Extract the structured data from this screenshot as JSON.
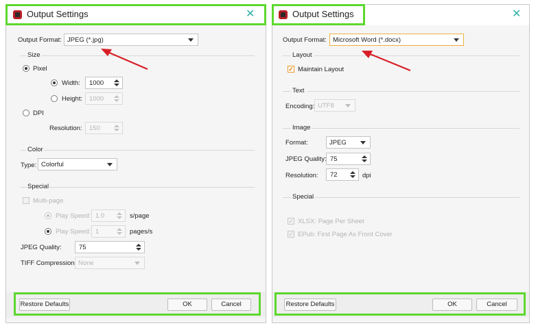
{
  "left": {
    "title": "Output Settings",
    "output_format_label": "Output Format:",
    "output_format_value": "JPEG (*.jpg)",
    "size_section": "Size",
    "pixel_label": "Pixel",
    "width_label": "Width:",
    "width_value": "1000",
    "height_label": "Height:",
    "height_value": "1000",
    "dpi_label": "DPI",
    "resolution_label": "Resolution:",
    "resolution_value": "150",
    "color_section": "Color",
    "type_label": "Type:",
    "type_value": "Colorful",
    "special_section": "Special",
    "multipage_label": "Multi-page",
    "play_speed_label_1": "Play Speed:",
    "play_speed_value_1": "1.0",
    "play_speed_unit_1": "s/page",
    "play_speed_label_2": "Play Speed:",
    "play_speed_value_2": "1",
    "play_speed_unit_2": "pages/s",
    "jpeg_quality_label": "JPEG Quality:",
    "jpeg_quality_value": "75",
    "tiff_label": "TIFF Compression:",
    "tiff_value": "None",
    "restore_label": "Restore Defaults",
    "ok_label": "OK",
    "cancel_label": "Cancel"
  },
  "right": {
    "title": "Output Settings",
    "output_format_label": "Output Format:",
    "output_format_value": "Microsoft Word (*.docx)",
    "layout_section": "Layout",
    "maintain_layout_label": "Maintain Layout",
    "text_section": "Text",
    "encoding_label": "Encoding:",
    "encoding_value": "UTF8",
    "image_section": "Image",
    "format_label": "Format:",
    "format_value": "JPEG",
    "jpeg_quality_label": "JPEG Quality:",
    "jpeg_quality_value": "75",
    "resolution_label": "Resolution:",
    "resolution_value": "72",
    "resolution_unit": "dpi",
    "special_section": "Special",
    "xlsx_label": "XLSX: Page Per Sheet",
    "epub_label": "EPub: First Page As Front Cover",
    "restore_label": "Restore Defaults",
    "ok_label": "OK",
    "cancel_label": "Cancel"
  },
  "colors": {
    "highlight_box": "#5cd82e",
    "annotation_arrow": "#d81f26",
    "close_icon": "#2fb1a8",
    "checkbox_accent": "#e89c2a"
  }
}
